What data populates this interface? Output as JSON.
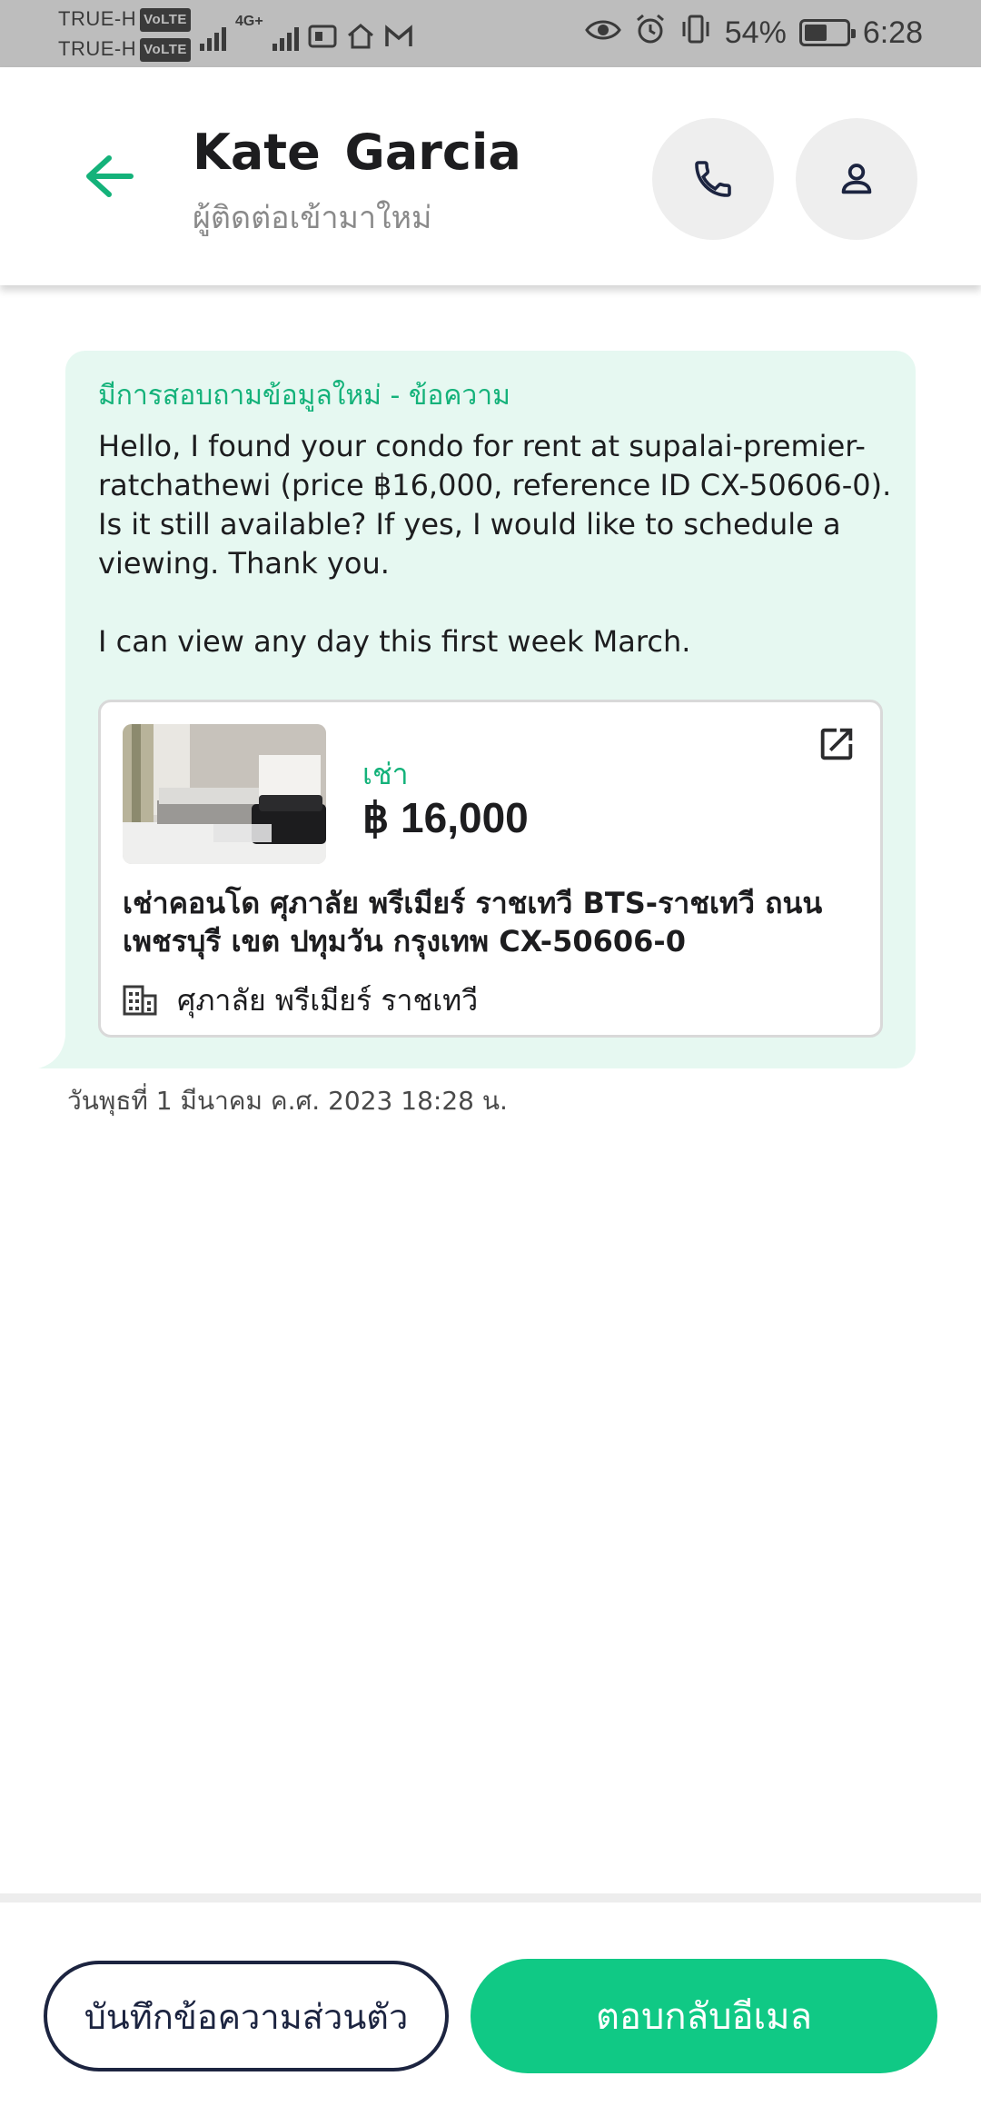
{
  "status_bar": {
    "carrier_1": "TRUE-H",
    "carrier_2": "TRUE-H",
    "volte": "VoLTE",
    "network": "4G+",
    "battery": "54%",
    "battery_level": 0.54,
    "time": "6:28"
  },
  "header": {
    "name": "Kate  Garcia",
    "subtitle": "ผู้ติดต่อเข้ามาใหม่",
    "back_icon": "arrow-left-icon",
    "call_icon": "phone-icon",
    "profile_icon": "person-icon",
    "accent_color": "#14b27a"
  },
  "message": {
    "label": "มีการสอบถามข้อมูลใหม่ - ข้อความ",
    "body": "Hello, I found your condo for rent at supalai-premier-ratchathewi (price ฿16,000, reference ID CX-50606-0). Is it still available? If yes, I would like to schedule a viewing. Thank you.\n\nI can view any day this first week March.",
    "timestamp": "วันพุธที่ 1 มีนาคม ค.ศ. 2023 18:28 น."
  },
  "listing": {
    "type": "เช่า",
    "price": "฿ 16,000",
    "title": "เช่าคอนโด  ศุภาลัย พรีเมียร์ ราชเทวี BTS-ราชเทวี ถนนเพชรบุรี เขต ปทุมวัน กรุงเทพ CX-50606-0",
    "project": "ศุภาลัย พรีเมียร์ ราชเทวี",
    "project_icon": "building-icon",
    "open_icon": "open-external-icon"
  },
  "actions": {
    "note_label": "บันทึกข้อความส่วนตัว",
    "reply_label": "ตอบกลับอีเมล",
    "reply_color": "#10c985"
  }
}
